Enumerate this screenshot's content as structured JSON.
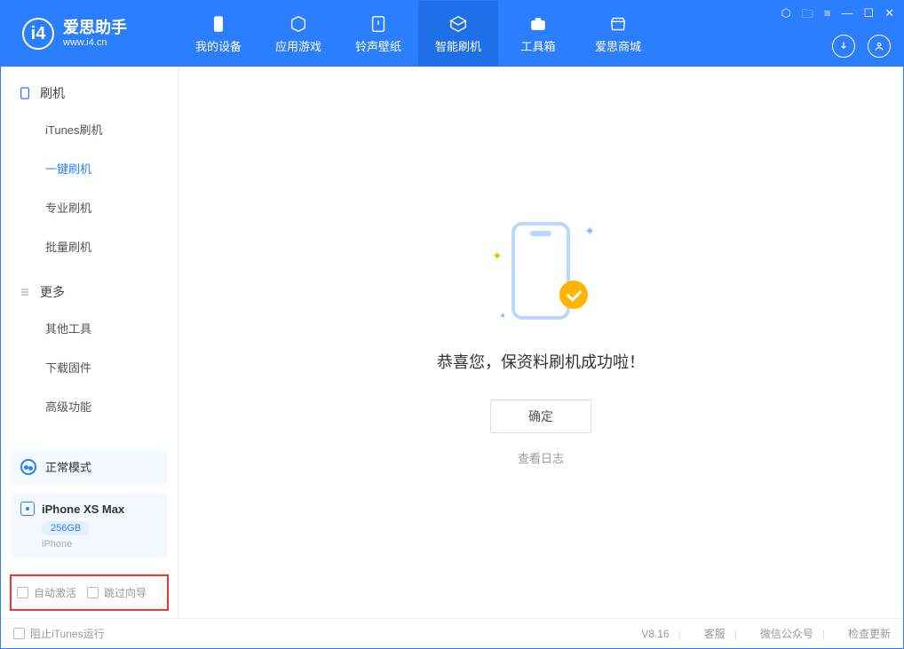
{
  "header": {
    "logo_title": "爱思助手",
    "logo_sub": "www.i4.cn",
    "nav": [
      {
        "label": "我的设备",
        "icon": "phone-icon"
      },
      {
        "label": "应用游戏",
        "icon": "cube-icon"
      },
      {
        "label": "铃声壁纸",
        "icon": "music-icon"
      },
      {
        "label": "智能刷机",
        "icon": "refresh-icon"
      },
      {
        "label": "工具箱",
        "icon": "toolbox-icon"
      },
      {
        "label": "爱思商城",
        "icon": "store-icon"
      }
    ]
  },
  "sidebar": {
    "group1_label": "刷机",
    "group1_items": [
      {
        "label": "iTunes刷机"
      },
      {
        "label": "一键刷机"
      },
      {
        "label": "专业刷机"
      },
      {
        "label": "批量刷机"
      }
    ],
    "group2_label": "更多",
    "group2_items": [
      {
        "label": "其他工具"
      },
      {
        "label": "下载固件"
      },
      {
        "label": "高级功能"
      }
    ],
    "status_label": "正常模式",
    "device_name": "iPhone XS Max",
    "device_capacity": "256GB",
    "device_type": "iPhone",
    "check_auto_activate": "自动激活",
    "check_skip_guide": "跳过向导"
  },
  "main": {
    "success_message": "恭喜您，保资料刷机成功啦！",
    "ok_button": "确定",
    "view_log": "查看日志"
  },
  "footer": {
    "block_itunes": "阻止iTunes运行",
    "version": "V8.16",
    "service": "客服",
    "wechat": "微信公众号",
    "check_update": "检查更新"
  }
}
